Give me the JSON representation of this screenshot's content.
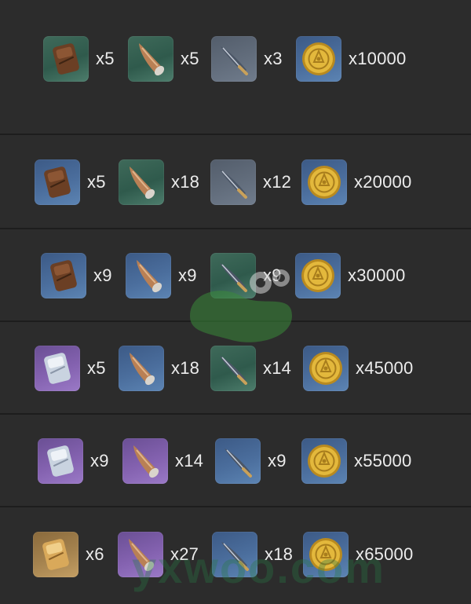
{
  "rows": [
    {
      "items": [
        {
          "icon": "leather-pouch-icon",
          "rarity": "green",
          "qty": "x5"
        },
        {
          "icon": "horn-icon",
          "rarity": "green",
          "qty": "x5"
        },
        {
          "icon": "feather-blade-icon",
          "rarity": "gray",
          "qty": "x3"
        },
        {
          "icon": "gold-coin-icon",
          "rarity": "blue",
          "qty": "x10000"
        }
      ]
    },
    {
      "items": [
        {
          "icon": "leather-pouch-icon",
          "rarity": "blue",
          "qty": "x5"
        },
        {
          "icon": "horn-icon",
          "rarity": "green",
          "qty": "x18"
        },
        {
          "icon": "feather-blade-icon",
          "rarity": "gray",
          "qty": "x12"
        },
        {
          "icon": "gold-coin-icon",
          "rarity": "blue",
          "qty": "x20000"
        }
      ]
    },
    {
      "items": [
        {
          "icon": "leather-pouch-icon",
          "rarity": "blue",
          "qty": "x9"
        },
        {
          "icon": "horn-icon",
          "rarity": "blue",
          "qty": "x9"
        },
        {
          "icon": "feather-blade-icon",
          "rarity": "green",
          "qty": "x9"
        },
        {
          "icon": "gold-coin-icon",
          "rarity": "blue",
          "qty": "x30000"
        }
      ]
    },
    {
      "items": [
        {
          "icon": "crystal-pouch-icon",
          "rarity": "purple",
          "qty": "x5"
        },
        {
          "icon": "horn-icon",
          "rarity": "blue",
          "qty": "x18"
        },
        {
          "icon": "feather-blade-icon",
          "rarity": "green",
          "qty": "x14"
        },
        {
          "icon": "gold-coin-icon",
          "rarity": "blue",
          "qty": "x45000"
        }
      ]
    },
    {
      "items": [
        {
          "icon": "crystal-pouch-icon",
          "rarity": "purple",
          "qty": "x9"
        },
        {
          "icon": "horn-icon",
          "rarity": "purple",
          "qty": "x14"
        },
        {
          "icon": "feather-blade-icon",
          "rarity": "blue",
          "qty": "x9"
        },
        {
          "icon": "gold-coin-icon",
          "rarity": "blue",
          "qty": "x55000"
        }
      ]
    },
    {
      "items": [
        {
          "icon": "golden-pouch-icon",
          "rarity": "gold",
          "qty": "x6"
        },
        {
          "icon": "horn-icon",
          "rarity": "purple",
          "qty": "x27"
        },
        {
          "icon": "feather-blade-icon",
          "rarity": "blue",
          "qty": "x18"
        },
        {
          "icon": "gold-coin-icon",
          "rarity": "blue",
          "qty": "x65000"
        }
      ]
    }
  ],
  "watermark_text": "yxwoo.com",
  "colors": {
    "background": "#2b2b2b",
    "row_divider": "#1d1d1d",
    "text": "#ececec",
    "coin": "#e3b83c"
  }
}
